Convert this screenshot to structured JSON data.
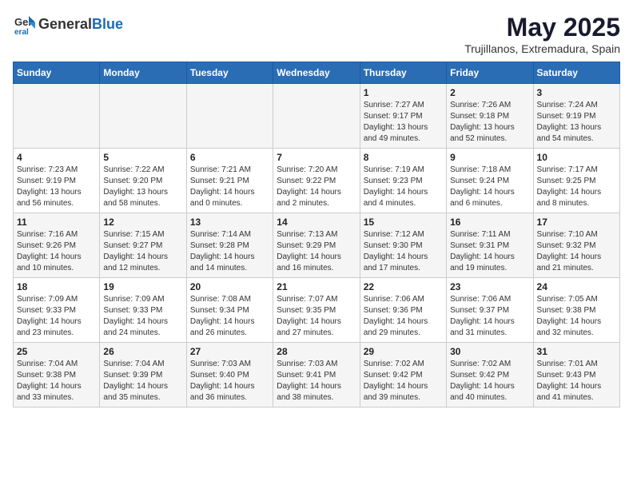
{
  "header": {
    "logo_general": "General",
    "logo_blue": "Blue",
    "title": "May 2025",
    "subtitle": "Trujillanos, Extremadura, Spain"
  },
  "days_of_week": [
    "Sunday",
    "Monday",
    "Tuesday",
    "Wednesday",
    "Thursday",
    "Friday",
    "Saturday"
  ],
  "weeks": [
    [
      {
        "day": "",
        "info": ""
      },
      {
        "day": "",
        "info": ""
      },
      {
        "day": "",
        "info": ""
      },
      {
        "day": "",
        "info": ""
      },
      {
        "day": "1",
        "info": "Sunrise: 7:27 AM\nSunset: 9:17 PM\nDaylight: 13 hours\nand 49 minutes."
      },
      {
        "day": "2",
        "info": "Sunrise: 7:26 AM\nSunset: 9:18 PM\nDaylight: 13 hours\nand 52 minutes."
      },
      {
        "day": "3",
        "info": "Sunrise: 7:24 AM\nSunset: 9:19 PM\nDaylight: 13 hours\nand 54 minutes."
      }
    ],
    [
      {
        "day": "4",
        "info": "Sunrise: 7:23 AM\nSunset: 9:19 PM\nDaylight: 13 hours\nand 56 minutes."
      },
      {
        "day": "5",
        "info": "Sunrise: 7:22 AM\nSunset: 9:20 PM\nDaylight: 13 hours\nand 58 minutes."
      },
      {
        "day": "6",
        "info": "Sunrise: 7:21 AM\nSunset: 9:21 PM\nDaylight: 14 hours\nand 0 minutes."
      },
      {
        "day": "7",
        "info": "Sunrise: 7:20 AM\nSunset: 9:22 PM\nDaylight: 14 hours\nand 2 minutes."
      },
      {
        "day": "8",
        "info": "Sunrise: 7:19 AM\nSunset: 9:23 PM\nDaylight: 14 hours\nand 4 minutes."
      },
      {
        "day": "9",
        "info": "Sunrise: 7:18 AM\nSunset: 9:24 PM\nDaylight: 14 hours\nand 6 minutes."
      },
      {
        "day": "10",
        "info": "Sunrise: 7:17 AM\nSunset: 9:25 PM\nDaylight: 14 hours\nand 8 minutes."
      }
    ],
    [
      {
        "day": "11",
        "info": "Sunrise: 7:16 AM\nSunset: 9:26 PM\nDaylight: 14 hours\nand 10 minutes."
      },
      {
        "day": "12",
        "info": "Sunrise: 7:15 AM\nSunset: 9:27 PM\nDaylight: 14 hours\nand 12 minutes."
      },
      {
        "day": "13",
        "info": "Sunrise: 7:14 AM\nSunset: 9:28 PM\nDaylight: 14 hours\nand 14 minutes."
      },
      {
        "day": "14",
        "info": "Sunrise: 7:13 AM\nSunset: 9:29 PM\nDaylight: 14 hours\nand 16 minutes."
      },
      {
        "day": "15",
        "info": "Sunrise: 7:12 AM\nSunset: 9:30 PM\nDaylight: 14 hours\nand 17 minutes."
      },
      {
        "day": "16",
        "info": "Sunrise: 7:11 AM\nSunset: 9:31 PM\nDaylight: 14 hours\nand 19 minutes."
      },
      {
        "day": "17",
        "info": "Sunrise: 7:10 AM\nSunset: 9:32 PM\nDaylight: 14 hours\nand 21 minutes."
      }
    ],
    [
      {
        "day": "18",
        "info": "Sunrise: 7:09 AM\nSunset: 9:33 PM\nDaylight: 14 hours\nand 23 minutes."
      },
      {
        "day": "19",
        "info": "Sunrise: 7:09 AM\nSunset: 9:33 PM\nDaylight: 14 hours\nand 24 minutes."
      },
      {
        "day": "20",
        "info": "Sunrise: 7:08 AM\nSunset: 9:34 PM\nDaylight: 14 hours\nand 26 minutes."
      },
      {
        "day": "21",
        "info": "Sunrise: 7:07 AM\nSunset: 9:35 PM\nDaylight: 14 hours\nand 27 minutes."
      },
      {
        "day": "22",
        "info": "Sunrise: 7:06 AM\nSunset: 9:36 PM\nDaylight: 14 hours\nand 29 minutes."
      },
      {
        "day": "23",
        "info": "Sunrise: 7:06 AM\nSunset: 9:37 PM\nDaylight: 14 hours\nand 31 minutes."
      },
      {
        "day": "24",
        "info": "Sunrise: 7:05 AM\nSunset: 9:38 PM\nDaylight: 14 hours\nand 32 minutes."
      }
    ],
    [
      {
        "day": "25",
        "info": "Sunrise: 7:04 AM\nSunset: 9:38 PM\nDaylight: 14 hours\nand 33 minutes."
      },
      {
        "day": "26",
        "info": "Sunrise: 7:04 AM\nSunset: 9:39 PM\nDaylight: 14 hours\nand 35 minutes."
      },
      {
        "day": "27",
        "info": "Sunrise: 7:03 AM\nSunset: 9:40 PM\nDaylight: 14 hours\nand 36 minutes."
      },
      {
        "day": "28",
        "info": "Sunrise: 7:03 AM\nSunset: 9:41 PM\nDaylight: 14 hours\nand 38 minutes."
      },
      {
        "day": "29",
        "info": "Sunrise: 7:02 AM\nSunset: 9:42 PM\nDaylight: 14 hours\nand 39 minutes."
      },
      {
        "day": "30",
        "info": "Sunrise: 7:02 AM\nSunset: 9:42 PM\nDaylight: 14 hours\nand 40 minutes."
      },
      {
        "day": "31",
        "info": "Sunrise: 7:01 AM\nSunset: 9:43 PM\nDaylight: 14 hours\nand 41 minutes."
      }
    ]
  ]
}
